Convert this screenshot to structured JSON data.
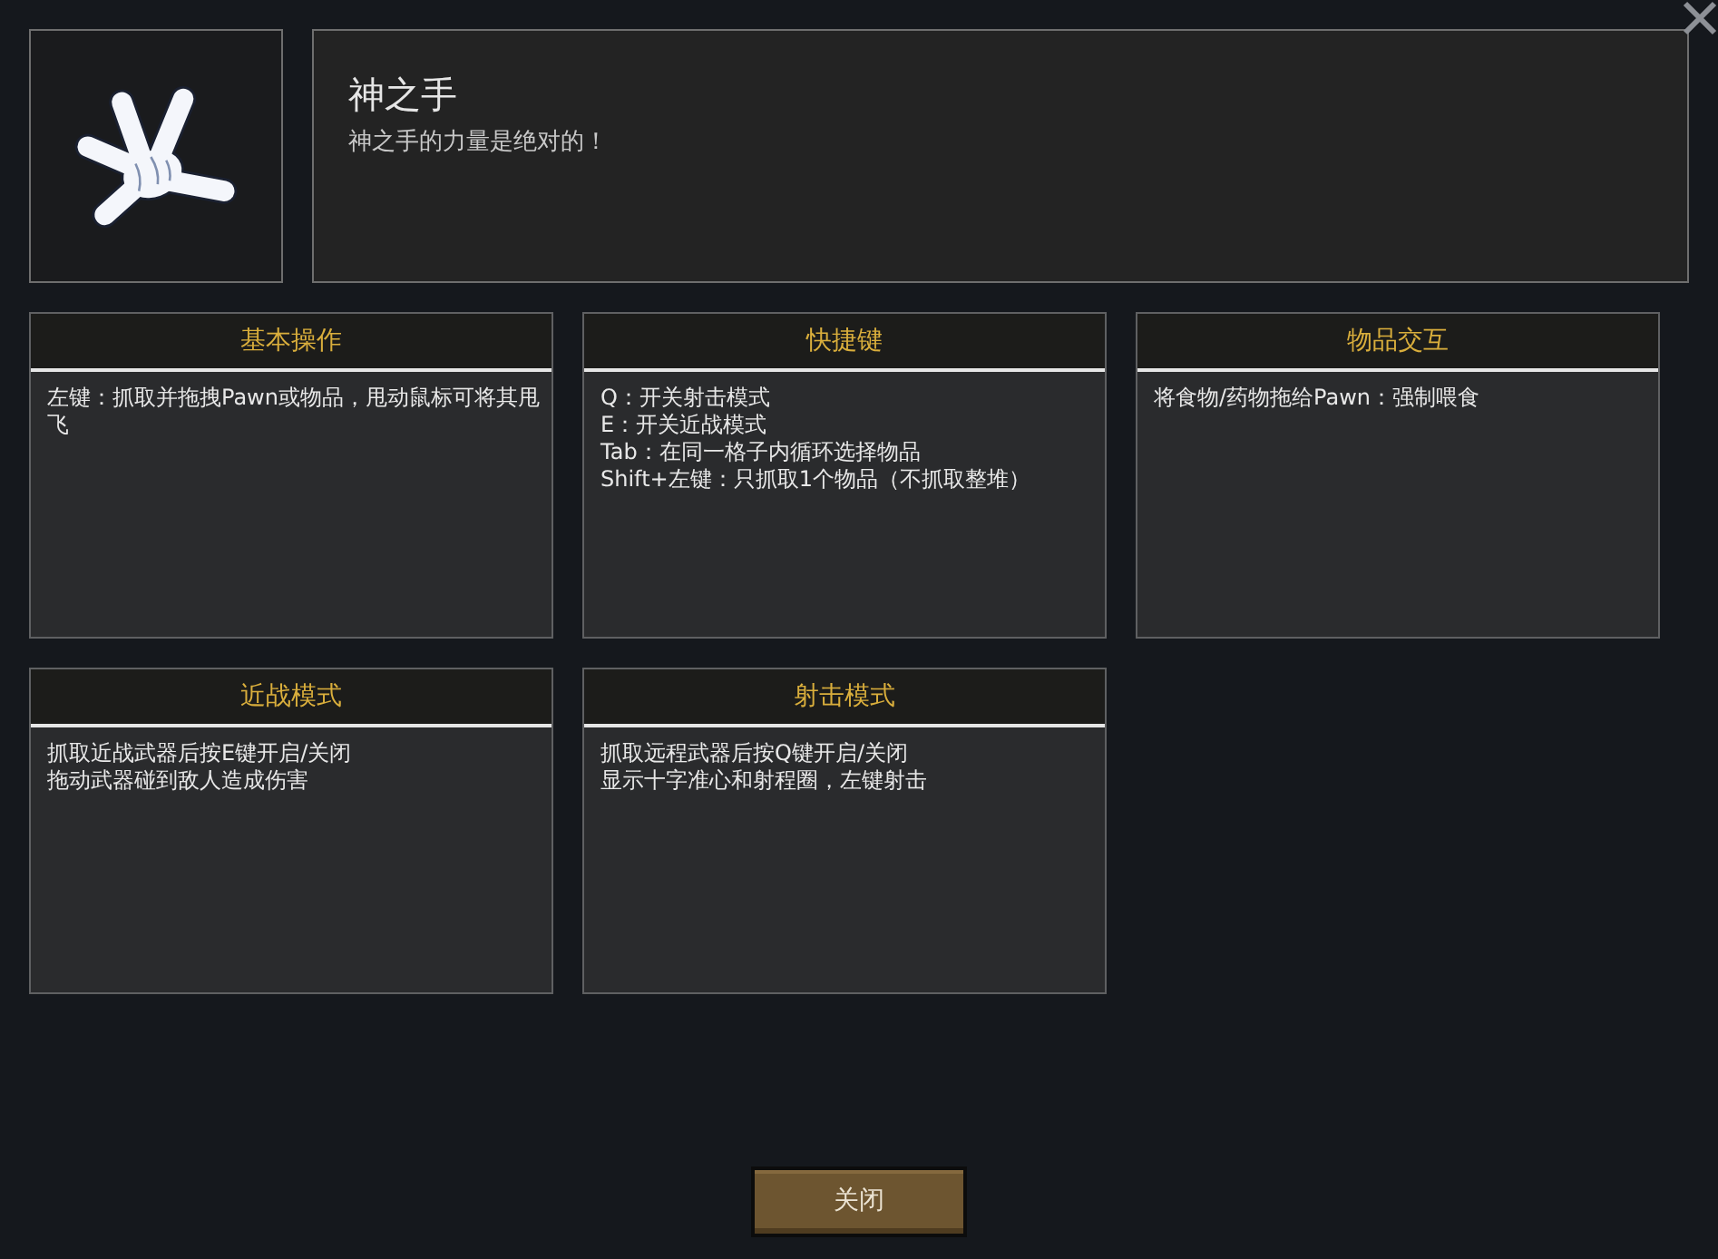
{
  "header": {
    "title": "神之手",
    "description": "神之手的力量是绝对的！"
  },
  "cards": [
    {
      "title": "基本操作",
      "lines": [
        "左键：抓取并拖拽Pawn或物品，甩动鼠标可将其甩飞"
      ]
    },
    {
      "title": "快捷键",
      "lines": [
        "Q：开关射击模式",
        "E：开关近战模式",
        "Tab：在同一格子内循环选择物品",
        "Shift+左键：只抓取1个物品（不抓取整堆）"
      ]
    },
    {
      "title": "物品交互",
      "lines": [
        "将食物/药物拖给Pawn：强制喂食"
      ]
    },
    {
      "title": "近战模式",
      "lines": [
        "抓取近战武器后按E键开启/关闭",
        "拖动武器碰到敌人造成伤害"
      ]
    },
    {
      "title": "射击模式",
      "lines": [
        "抓取远程武器后按Q键开启/关闭",
        "显示十字准心和射程圈，左键射击"
      ]
    }
  ],
  "close_button": {
    "label": "关闭"
  }
}
